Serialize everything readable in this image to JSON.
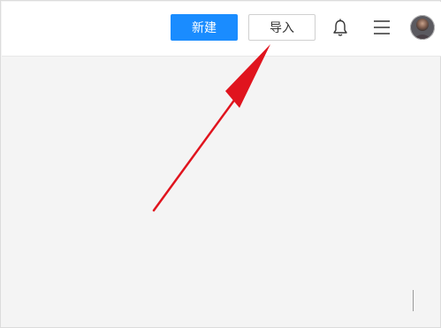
{
  "header": {
    "new_label": "新建",
    "import_label": "导入"
  },
  "icons": {
    "bell": "bell-icon",
    "menu": "hamburger-menu-icon",
    "avatar": "user-avatar"
  },
  "annotation": {
    "arrow_color": "#e0141e"
  },
  "colors": {
    "primary": "#1a8cff",
    "background": "#f4f4f4"
  }
}
